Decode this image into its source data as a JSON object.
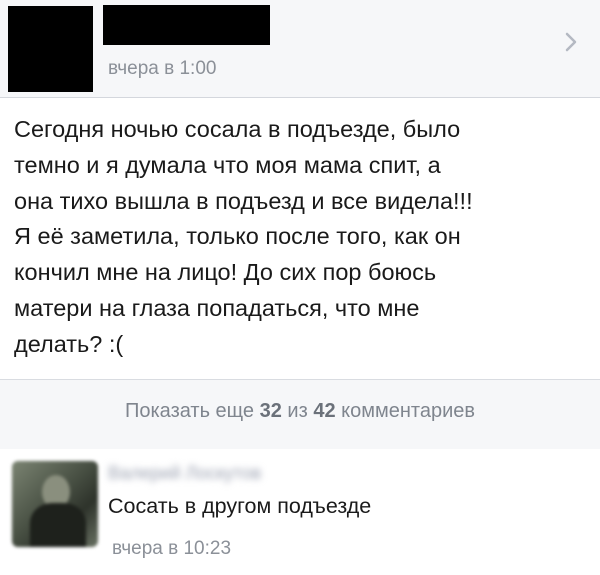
{
  "post": {
    "author_name": "",
    "time": "вчера в 1:00",
    "text_lines": [
      "Сегодня ночью сосала в подъезде, было",
      "темно и я думала что моя мама спит, а",
      "она тихо вышла в подъезд и все видела!!!",
      "Я её заметила, только после того, как он",
      "кончил мне на лицо! До сих пор боюсь",
      "матери на глаза попадаться, что мне",
      "делать? :("
    ]
  },
  "comments_bar": {
    "prefix": "Показать еще",
    "shown": "32",
    "middle": "из",
    "total": "42",
    "suffix": "комментариев"
  },
  "comment": {
    "author_name": "Валерий Лоскутов",
    "text": "Сосать в другом подъезде",
    "time": "вчера в 10:23"
  },
  "icons": {
    "chevron": "chevron-right-icon"
  },
  "colors": {
    "header_bg": "#f6f7f9",
    "meta_text": "#8b9098",
    "body_text": "#1a1a1a"
  }
}
